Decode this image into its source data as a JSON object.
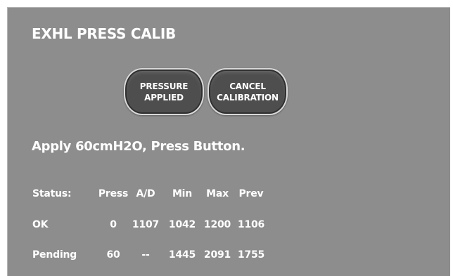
{
  "screen": {
    "title": "EXHL PRESS CALIB",
    "buttons": {
      "pressure_applied": {
        "line1": "PRESSURE",
        "line2": "APPLIED"
      },
      "cancel_calibration": {
        "line1": "CANCEL",
        "line2": "CALIBRATION"
      }
    },
    "instruction": "Apply 60cmH2O, Press Button.",
    "table": {
      "headers": [
        "Status:",
        "Press",
        "A/D",
        "Min",
        "Max",
        "Prev"
      ],
      "rows": [
        [
          "OK",
          "0",
          "1107",
          "1042",
          "1200",
          "1106"
        ],
        [
          "Pending",
          "60",
          "--",
          "1445",
          "2091",
          "1755"
        ]
      ]
    }
  },
  "colors": {
    "panel_background": "#8d8d8d",
    "button_fill": "#4e4e4e",
    "button_border": "#d9d9d9",
    "text": "#ffffff"
  }
}
